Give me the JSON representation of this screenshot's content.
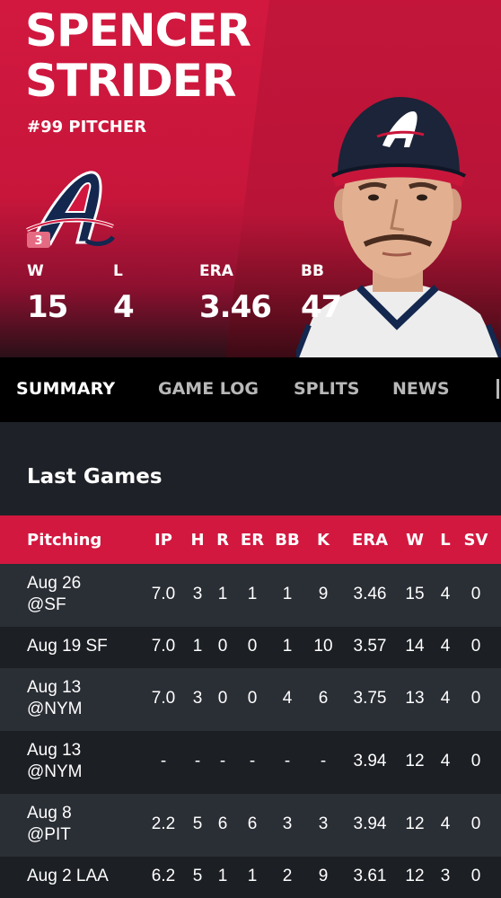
{
  "player": {
    "first_name": "SPENCER",
    "last_name": "STRIDER",
    "subtitle": "#99 PITCHER",
    "logo_badge": "3"
  },
  "stats": [
    {
      "label": "W",
      "value": "15"
    },
    {
      "label": "L",
      "value": "4"
    },
    {
      "label": "ERA",
      "value": "3.46"
    },
    {
      "label": "BB",
      "value": "47"
    }
  ],
  "tabs": [
    {
      "label": "SUMMARY",
      "active": true
    },
    {
      "label": "GAME LOG",
      "active": false
    },
    {
      "label": "SPLITS",
      "active": false
    },
    {
      "label": "NEWS",
      "active": false
    }
  ],
  "section": {
    "title": "Last Games"
  },
  "table": {
    "headers": [
      "Pitching",
      "IP",
      "H",
      "R",
      "ER",
      "BB",
      "K",
      "ERA",
      "W",
      "L",
      "SV"
    ],
    "rows": [
      {
        "game": "Aug 26\n@SF",
        "cells": [
          "7.0",
          "3",
          "1",
          "1",
          "1",
          "9",
          "3.46",
          "15",
          "4",
          "0"
        ]
      },
      {
        "game": "Aug 19 SF",
        "cells": [
          "7.0",
          "1",
          "0",
          "0",
          "1",
          "10",
          "3.57",
          "14",
          "4",
          "0"
        ]
      },
      {
        "game": "Aug 13\n@NYM",
        "cells": [
          "7.0",
          "3",
          "0",
          "0",
          "4",
          "6",
          "3.75",
          "13",
          "4",
          "0"
        ]
      },
      {
        "game": "Aug 13\n@NYM",
        "cells": [
          "-",
          "-",
          "-",
          "-",
          "-",
          "-",
          "3.94",
          "12",
          "4",
          "0"
        ]
      },
      {
        "game": "Aug 8\n@PIT",
        "cells": [
          "2.2",
          "5",
          "6",
          "6",
          "3",
          "3",
          "3.94",
          "12",
          "4",
          "0"
        ]
      },
      {
        "game": "Aug 2 LAA",
        "cells": [
          "6.2",
          "5",
          "1",
          "1",
          "2",
          "9",
          "3.61",
          "12",
          "3",
          "0"
        ]
      }
    ]
  },
  "colors": {
    "brand_red": "#d2183f",
    "navy": "#13274f"
  }
}
